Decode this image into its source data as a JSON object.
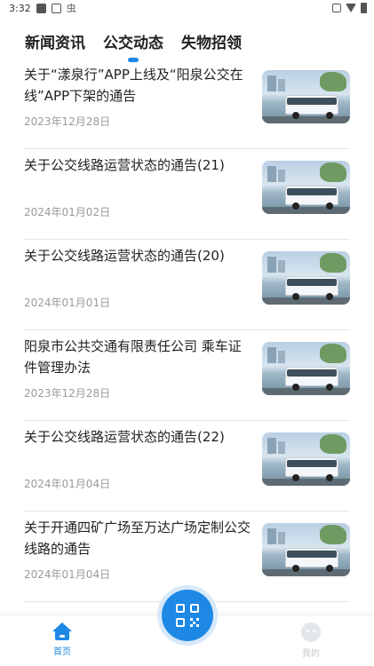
{
  "status_bar": {
    "time": "3:32",
    "icon_glyph": "虫"
  },
  "tabs": [
    {
      "label": "新闻资讯",
      "active": false
    },
    {
      "label": "公交动态",
      "active": true
    },
    {
      "label": "失物招领",
      "active": false
    }
  ],
  "news": [
    {
      "title": "关于“漾泉行”APP上线及“阳泉公交在线”APP下架的通告",
      "date": "2023年12月28日",
      "thumb": "bus-photo"
    },
    {
      "title": "关于公交线路运营状态的通告(21)",
      "date": "2024年01月02日",
      "thumb": "bus-photo"
    },
    {
      "title": "关于公交线路运营状态的通告(20)",
      "date": "2024年01月01日",
      "thumb": "bus-photo"
    },
    {
      "title": "阳泉市公共交通有限责任公司 乘车证件管理办法",
      "date": "2023年12月28日",
      "thumb": "bus-photo"
    },
    {
      "title": "关于公交线路运营状态的通告(22)",
      "date": "2024年01月04日",
      "thumb": "bus-photo"
    },
    {
      "title": "关于开通四矿广场至万达广场定制公交线路的通告",
      "date": "2024年01月04日",
      "thumb": "bus-photo"
    }
  ],
  "bottom_nav": {
    "home_label": "首页",
    "mine_label": "我的",
    "center_icon": "qr-scan-icon"
  },
  "colors": {
    "accent": "#1e88e5",
    "text": "#222222",
    "date": "#9a9a9a"
  }
}
